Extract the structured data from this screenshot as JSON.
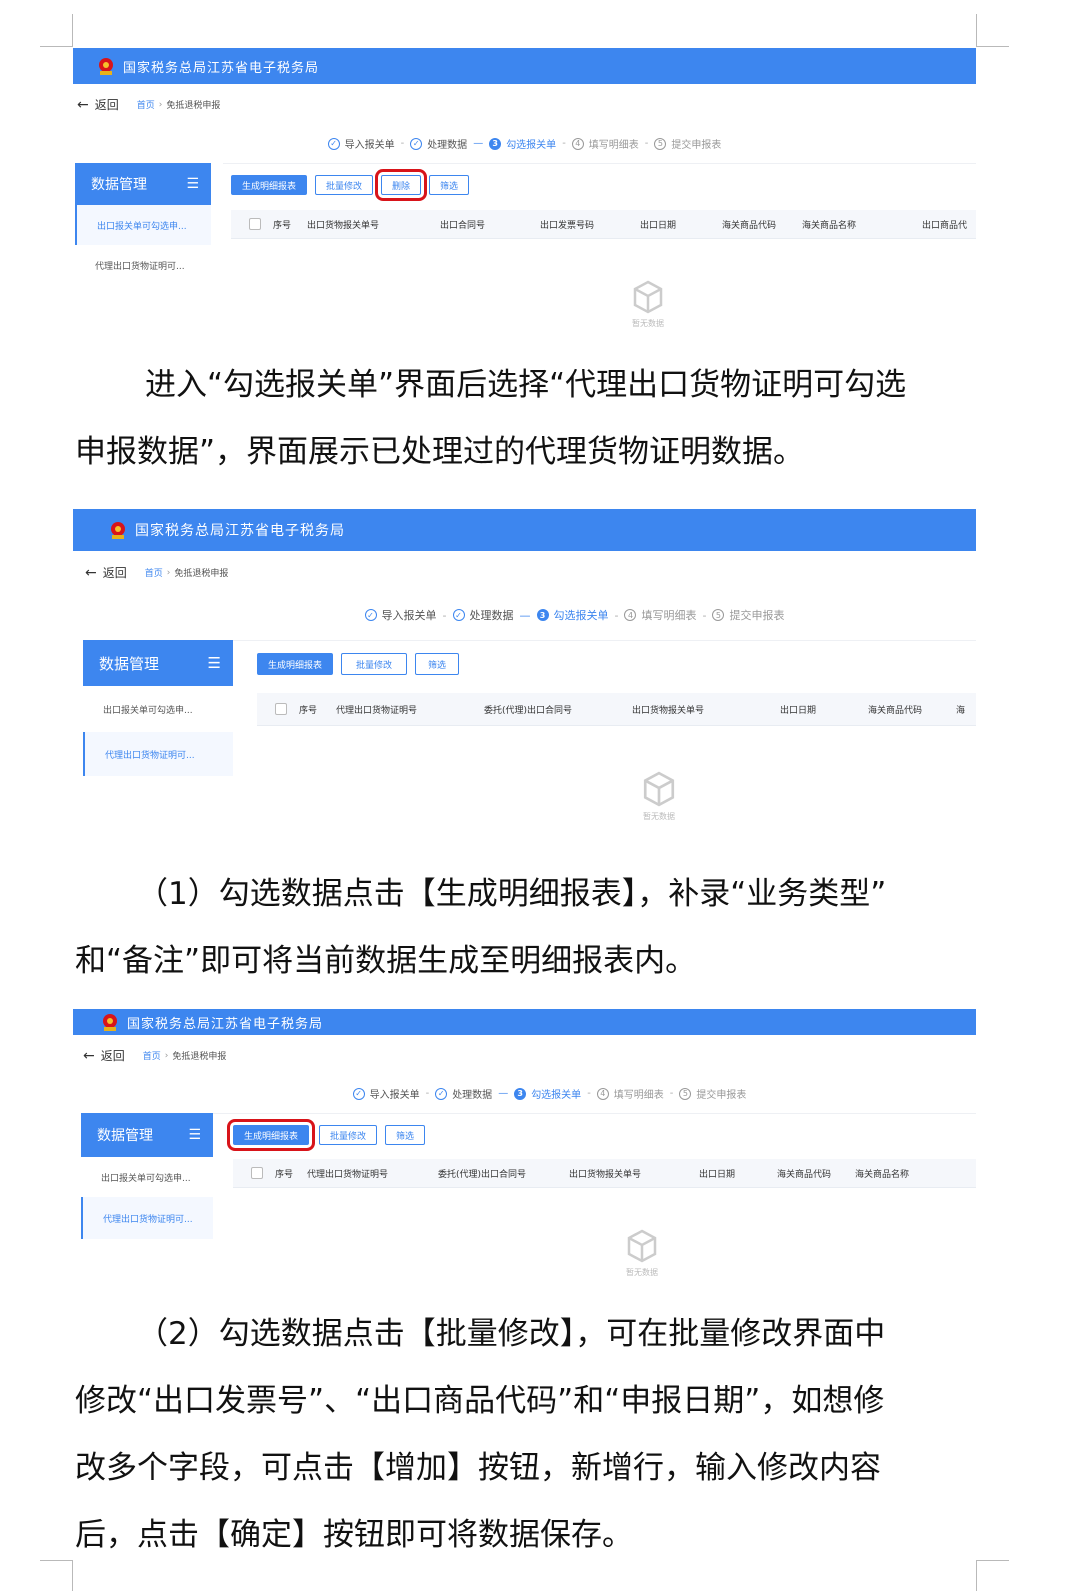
{
  "app_title": "国家税务总局江苏省电子税务局",
  "nav": {
    "back": "返回",
    "home": "首页",
    "sep": "›",
    "current": "免抵退税申报"
  },
  "steps": [
    {
      "num": "✓",
      "label": "导入报关单",
      "state": "done"
    },
    {
      "num": "✓",
      "label": "处理数据",
      "state": "done"
    },
    {
      "num": "3",
      "label": "勾选报关单",
      "state": "active"
    },
    {
      "num": "4",
      "label": "填写明细表",
      "state": "todo"
    },
    {
      "num": "5",
      "label": "提交申报表",
      "state": "todo"
    }
  ],
  "sidebar": {
    "title": "数据管理",
    "items": [
      "出口报关单可勾选申...",
      "代理出口货物证明可..."
    ]
  },
  "buttons": {
    "generate": "生成明细报表",
    "batch_edit": "批量修改",
    "delete": "删除",
    "filter": "筛选"
  },
  "table1_columns": [
    "序号",
    "出口货物报关单号",
    "出口合同号",
    "出口发票号码",
    "出口日期",
    "海关商品代码",
    "海关商品名称",
    "出口商品代"
  ],
  "table2_columns": [
    "序号",
    "代理出口货物证明号",
    "委托(代理)出口合同号",
    "出口货物报关单号",
    "出口日期",
    "海关商品代码",
    "海"
  ],
  "table3_columns": [
    "序号",
    "代理出口货物证明号",
    "委托(代理)出口合同号",
    "出口货物报关单号",
    "出口日期",
    "海关商品代码",
    "海关商品名称"
  ],
  "empty_text": "暂无数据",
  "paragraphs": {
    "p1": [
      "进入“勾选报关单”界面后选择“代理出口货物证明可勾选",
      "申报数据”，界面展示已处理过的代理货物证明数据。"
    ],
    "p2": [
      "（1）勾选数据点击【生成明细报表】，补录“业务类型”",
      "和“备注”即可将当前数据生成至明细报表内。"
    ],
    "p3": [
      "（2）勾选数据点击【批量修改】，可在批量修改界面中",
      "修改“出口发票号”、“出口商品代码”和“申报日期”，如想修",
      "改多个字段，可点击【增加】按钮，新增行，输入修改内容",
      "后，点击【确定】按钮即可将数据保存。"
    ]
  }
}
